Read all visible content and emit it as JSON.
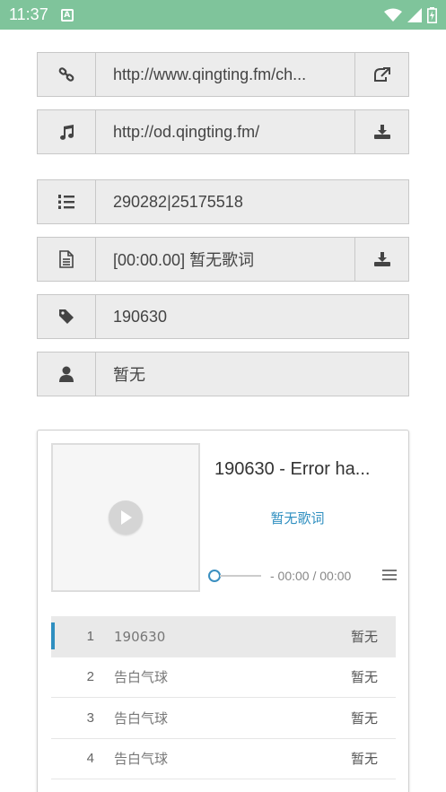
{
  "status": {
    "time": "11:37",
    "notif_glyph": "A"
  },
  "fields": [
    {
      "value": "http://www.qingting.fm/ch...",
      "lead_icon": "link-icon",
      "trail_icon": "external-link-icon"
    },
    {
      "value": "http://od.qingting.fm/",
      "lead_icon": "music-note-icon",
      "trail_icon": "download-icon"
    },
    {
      "value": "290282|25175518",
      "lead_icon": "ordered-list-icon"
    },
    {
      "value": "[00:00.00] 暂无歌词",
      "lead_icon": "document-icon",
      "trail_icon": "download-icon"
    },
    {
      "value": "190630",
      "lead_icon": "tag-icon"
    },
    {
      "value": "暂无",
      "lead_icon": "user-icon"
    }
  ],
  "player": {
    "title": "190630 - Error ha...",
    "lyric": "暂无歌词",
    "time": "- 00:00 / 00:00",
    "accent": "#2f8fc0"
  },
  "playlist": [
    {
      "num": "1",
      "name": "190630",
      "artist": "暂无",
      "active": true
    },
    {
      "num": "2",
      "name": "告白气球",
      "artist": "暂无"
    },
    {
      "num": "3",
      "name": "告白气球",
      "artist": "暂无"
    },
    {
      "num": "4",
      "name": "告白气球",
      "artist": "暂无"
    }
  ]
}
